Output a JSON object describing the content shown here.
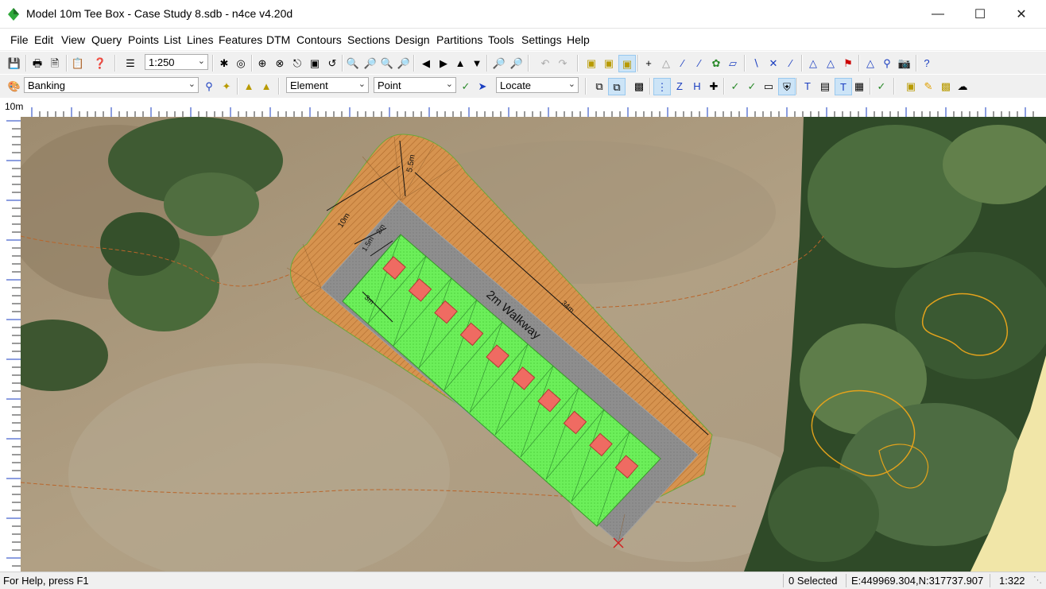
{
  "window": {
    "title": "Model 10m Tee Box - Case Study 8.sdb - n4ce v4.20d",
    "minimize_icon": "minimize-icon",
    "maximize_icon": "maximize-icon",
    "close_icon": "close-icon"
  },
  "menu": [
    "File",
    "Edit",
    "View",
    "Query",
    "Points",
    "List",
    "Lines",
    "Features",
    "DTM",
    "Contours",
    "Sections",
    "Design",
    "Partitions",
    "Tools",
    "Settings",
    "Help"
  ],
  "toolbar": {
    "scale": "1:250",
    "layer": "Banking",
    "element": "Element",
    "point": "Point",
    "locate": "Locate"
  },
  "ruler": {
    "scale_label": "10m"
  },
  "drawing": {
    "walkway_label": "2m Walkway",
    "dim_labels": [
      "5.5m",
      "10m",
      "1.5m",
      "2m",
      "3m",
      "34m"
    ]
  },
  "status": {
    "help": "For Help, press F1",
    "selected": "0 Selected",
    "coords": "E:449969.304,N:317737.907",
    "scale": "1:322"
  },
  "colors": {
    "pad_green": "#6cef5a",
    "walkway_grey": "#8e8e8e",
    "banking_orange": "#d6934f",
    "marker_red": "#ef6b62",
    "trees_dark": "#3a5a2a",
    "sand": "#f1e6a8"
  }
}
